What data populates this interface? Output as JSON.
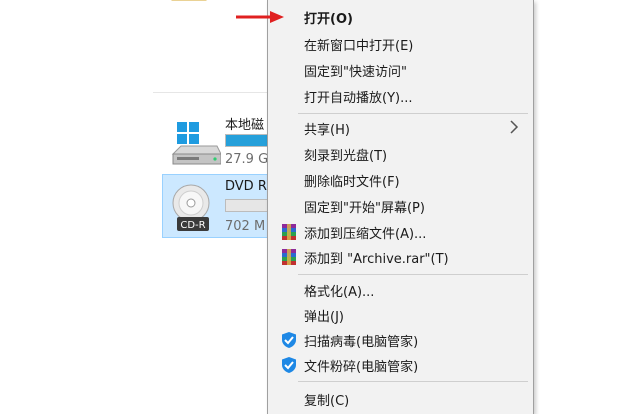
{
  "drives": [
    {
      "name": "本地磁",
      "size": "27.9 G",
      "usage_fraction": 1.0,
      "icon": "windows-drive-icon"
    },
    {
      "name": "DVD R",
      "size": "702 M",
      "usage_fraction": 0.0,
      "icon": "cd-r-icon",
      "badge": "CD-R",
      "selected": true
    }
  ],
  "context_menu": {
    "items": [
      {
        "label": "打开(O)",
        "bold": true
      },
      {
        "label": "在新窗口中打开(E)"
      },
      {
        "label": "固定到\"快速访问\""
      },
      {
        "label": "打开自动播放(Y)..."
      },
      {
        "label": "共享(H)",
        "submenu": true
      },
      {
        "label": "刻录到光盘(T)"
      },
      {
        "label": "删除临时文件(F)"
      },
      {
        "label": "固定到\"开始\"屏幕(P)"
      },
      {
        "label": "添加到压缩文件(A)...",
        "icon": "winrar-icon"
      },
      {
        "label": "添加到 \"Archive.rar\"(T)",
        "icon": "winrar-icon"
      },
      {
        "label": "格式化(A)..."
      },
      {
        "label": "弹出(J)"
      },
      {
        "label": "扫描病毒(电脑管家)",
        "icon": "tencent-shield-icon"
      },
      {
        "label": "文件粉碎(电脑管家)",
        "icon": "tencent-shield-icon"
      },
      {
        "label": "复制(C)"
      }
    ]
  },
  "colors": {
    "arrow": "#e02020",
    "selection_bg": "#cce8ff",
    "drive_bar": "#26a0da",
    "shield": "#1e88e5"
  }
}
